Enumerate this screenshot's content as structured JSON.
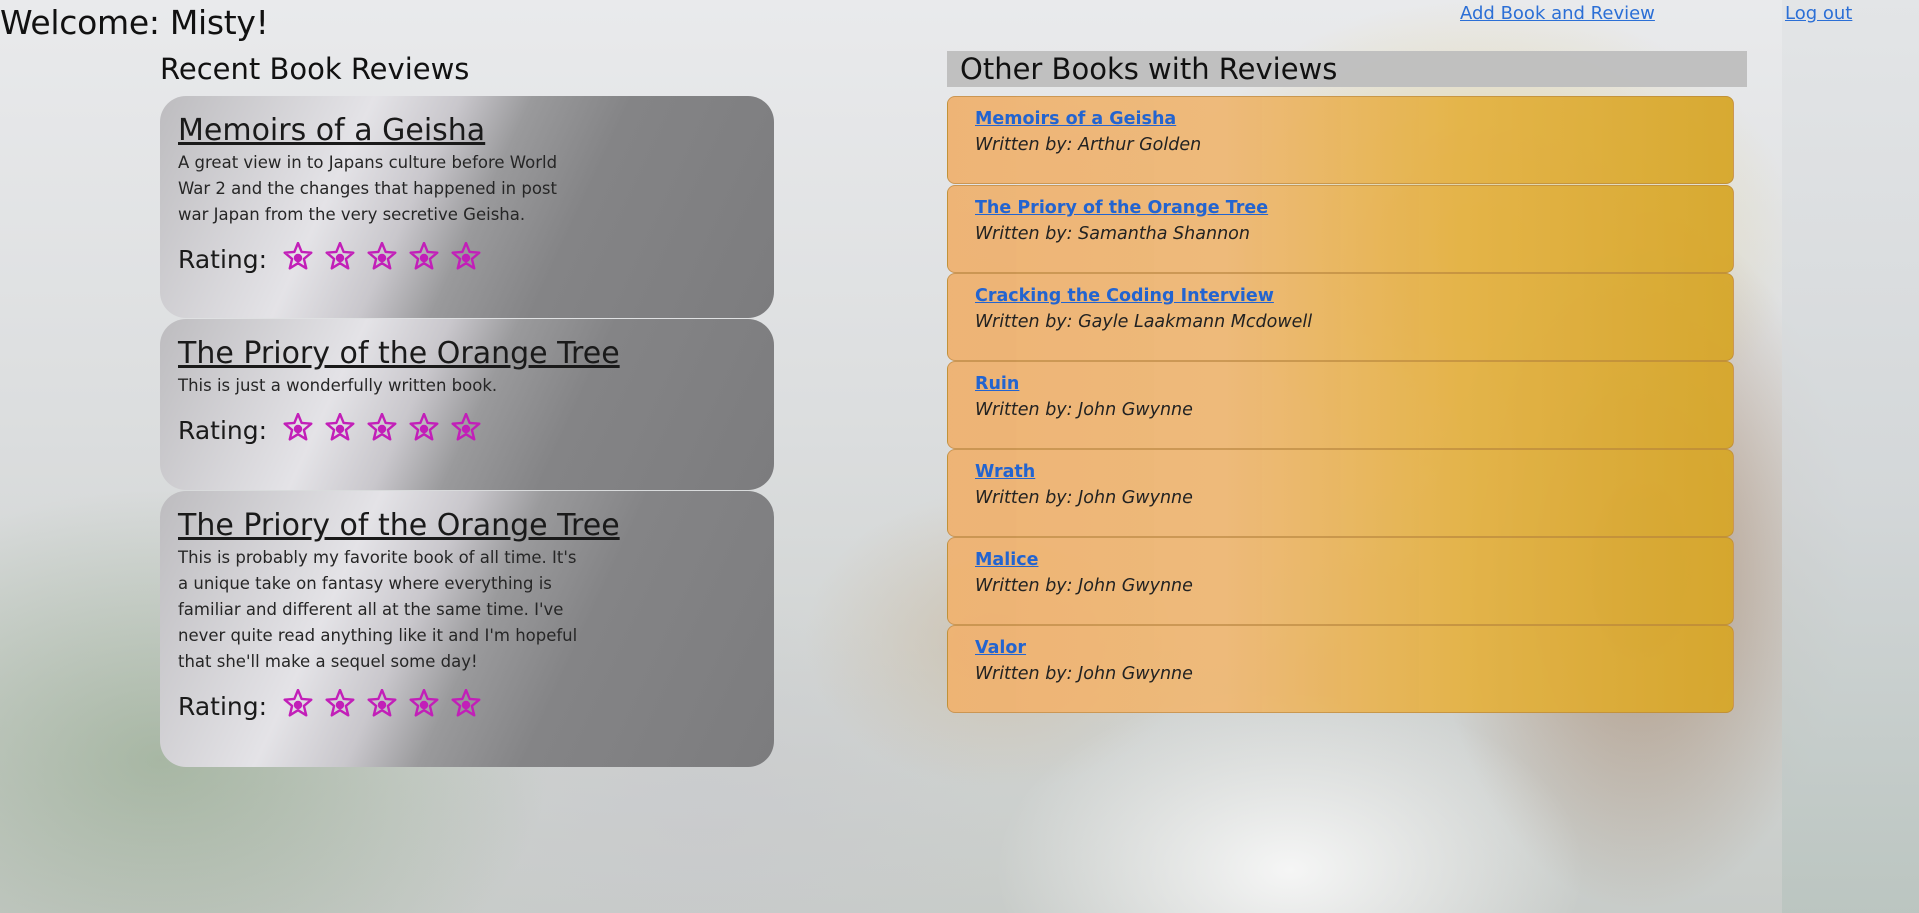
{
  "header": {
    "welcome": "Welcome: Misty!",
    "add_book_link": "Add Book and Review",
    "logout_link": "Log out"
  },
  "recent": {
    "title": "Recent Book Reviews",
    "rating_label": "Rating:",
    "reviews": [
      {
        "title": "Memoirs of a Geisha",
        "text": "A great view in to Japans culture before World War 2 and the changes that happened in post war Japan from the very secretive Geisha.",
        "rating": 5
      },
      {
        "title": "The Priory of the Orange Tree",
        "text": "This is just a wonderfully written book.",
        "rating": 5
      },
      {
        "title": "The Priory of the Orange Tree",
        "text": "This is probably my favorite book of all time. It's a unique take on fantasy where everything is familiar and different all at the same time. I've never quite read anything like it and I'm hopeful that she'll make a sequel some day!",
        "rating": 5
      }
    ]
  },
  "other": {
    "title": "Other Books with Reviews",
    "books": [
      {
        "title": "Memoirs of a Geisha",
        "author": "Written by: Arthur Golden"
      },
      {
        "title": "The Priory of the Orange Tree",
        "author": "Written by: Samantha Shannon"
      },
      {
        "title": "Cracking the Coding Interview",
        "author": "Written by: Gayle Laakmann Mcdowell"
      },
      {
        "title": "Ruin",
        "author": "Written by: John Gwynne"
      },
      {
        "title": "Wrath",
        "author": "Written by: John Gwynne"
      },
      {
        "title": "Malice",
        "author": "Written by: John Gwynne"
      },
      {
        "title": "Valor",
        "author": "Written by: John Gwynne"
      }
    ]
  },
  "colors": {
    "link": "#2364d0",
    "star": "#c21fb8",
    "book_card_left": "#eeb272",
    "book_card_right": "#d6a628"
  },
  "icons": {
    "star": "star-icon"
  }
}
